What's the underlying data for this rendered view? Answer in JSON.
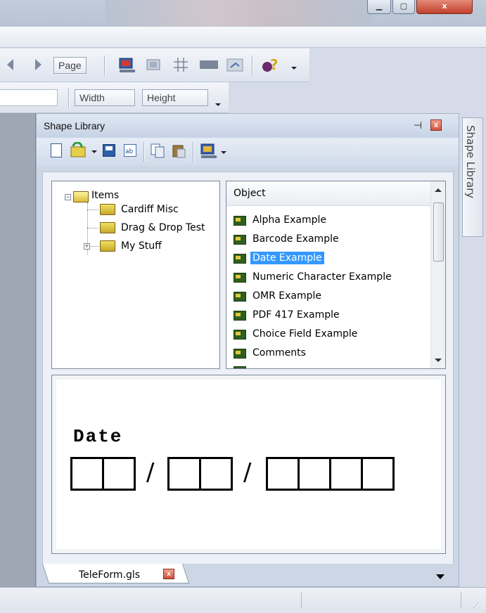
{
  "window": {
    "minimize_label": "▁",
    "maximize_label": "▢",
    "close_label": "x"
  },
  "toolbar": {
    "page_label": "Page",
    "width_label": "Width",
    "height_label": "Height"
  },
  "panel": {
    "title": "Shape Library",
    "pin_glyph": "⊣",
    "close_glyph": "x",
    "side_tab_label": "Shape Library"
  },
  "tree": {
    "root": "Items",
    "items": [
      "Cardiff Misc",
      "Drag & Drop Test",
      "My Stuff"
    ],
    "expander_collapsed": "−",
    "expander_expanded": "+"
  },
  "objects": {
    "header": "Object",
    "items": [
      "Alpha Example",
      "Barcode Example",
      "Date Example",
      "Numeric Character Example",
      "OMR Example",
      "PDF 417 Example",
      "Choice Field Example",
      "Comments"
    ],
    "selected_index": 2
  },
  "preview": {
    "label": "Date",
    "separator": "/"
  },
  "tab": {
    "label": "TeleForm.gls",
    "close_glyph": "x"
  },
  "colors": {
    "selection": "#3399ff",
    "panel_bg": "#ccd6e5",
    "close_red": "#c0402b"
  }
}
